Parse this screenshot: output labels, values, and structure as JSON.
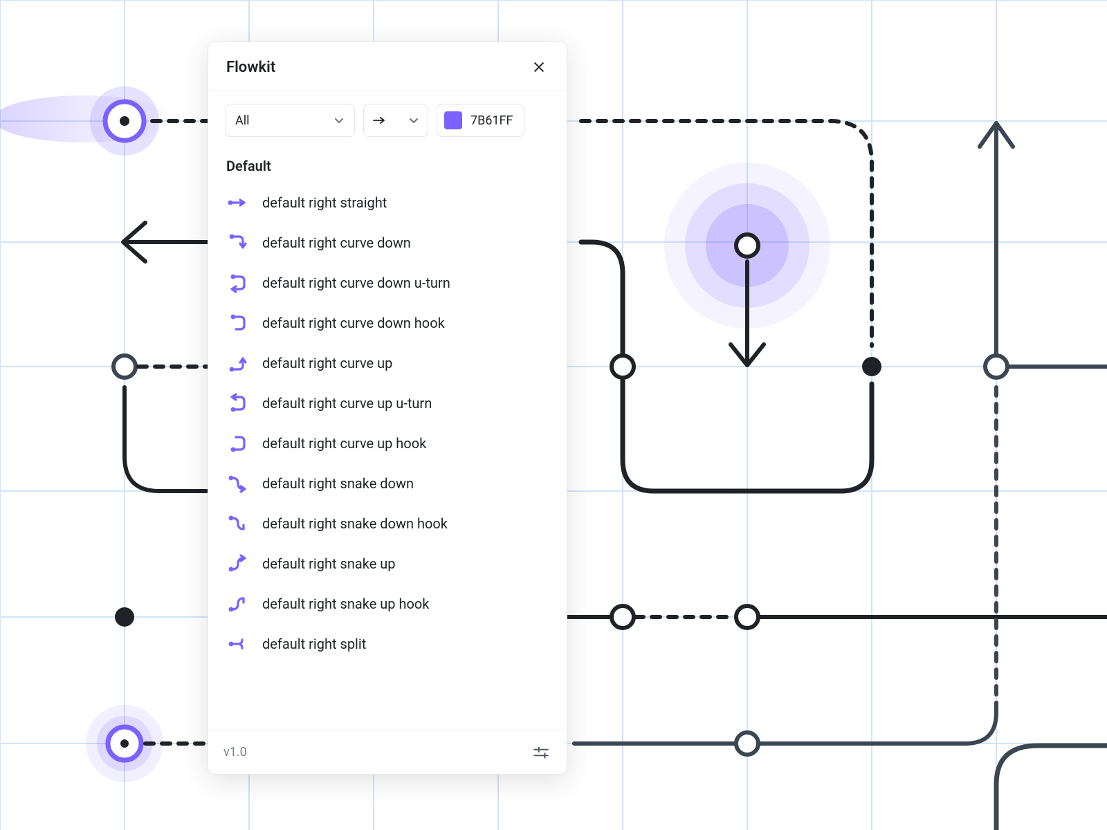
{
  "panel": {
    "title": "Flowkit",
    "controls": {
      "category": "All",
      "line_style": "arrow-solid",
      "color_hex": "7B61FF"
    },
    "section_label": "Default",
    "items": [
      {
        "label": "default right straight"
      },
      {
        "label": "default right curve down"
      },
      {
        "label": "default right curve down u-turn"
      },
      {
        "label": "default right curve down hook"
      },
      {
        "label": "default right curve up"
      },
      {
        "label": "default right curve up u-turn"
      },
      {
        "label": "default right curve up hook"
      },
      {
        "label": "default right snake down"
      },
      {
        "label": "default right snake down hook"
      },
      {
        "label": "default right snake up"
      },
      {
        "label": "default right snake up hook"
      },
      {
        "label": "default right split"
      }
    ],
    "footer": {
      "version": "v1.0"
    }
  },
  "colors": {
    "accent": "#7B61FF",
    "ink": "#1f2328",
    "ink_soft": "#3a4651",
    "grid": "#cfe3fb"
  }
}
